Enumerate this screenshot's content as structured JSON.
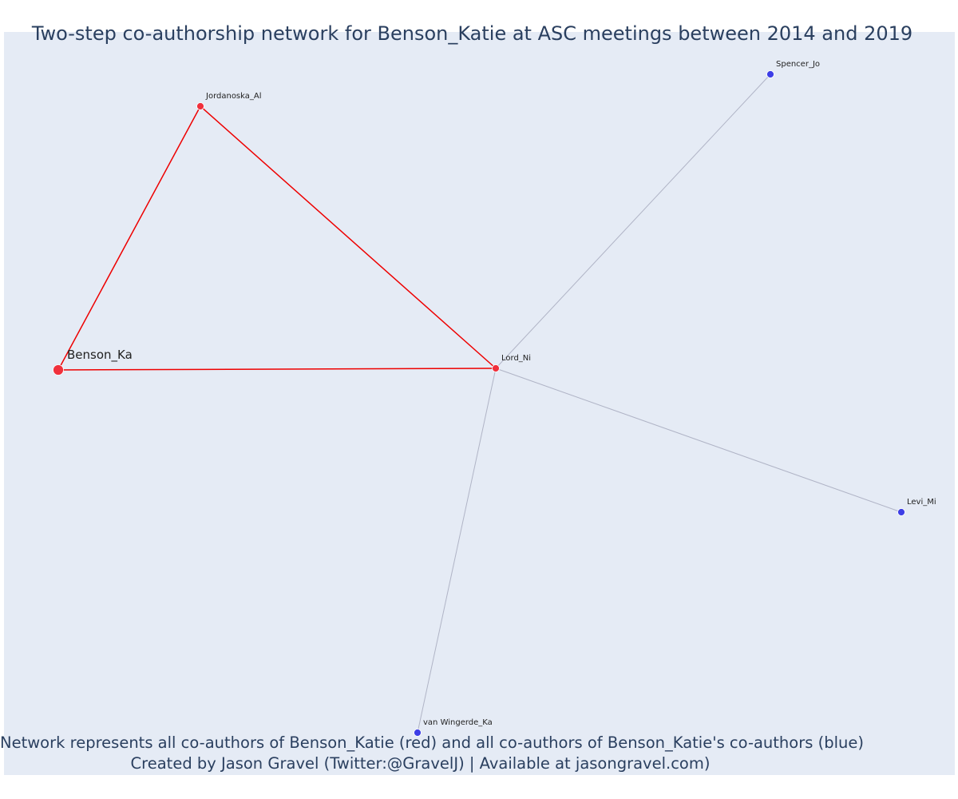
{
  "title": "Two-step co-authorship network for Benson_Katie at ASC meetings between 2014 and 2019",
  "caption": {
    "line1": "Network represents all co-authors of Benson_Katie (red) and all co-authors of Benson_Katie's co-authors (blue)",
    "line2": "Created by Jason Gravel (Twitter:@GravelJ) | Available at jasongravel.com)"
  },
  "colors": {
    "background": "#e5ebf5",
    "first_degree": "#f0303c",
    "second_degree": "#3d3ee6",
    "first_degree_edge": "#ee0000",
    "second_degree_edge": "#b0b4c6",
    "text": "#2a3f5f"
  },
  "nodes": [
    {
      "id": "Benson_Ka",
      "label": "Benson_Ka",
      "group": "focal"
    },
    {
      "id": "Jordanoska_Al",
      "label": "Jordanoska_Al",
      "group": "coauthor"
    },
    {
      "id": "Lord_Ni",
      "label": "Lord_Ni",
      "group": "coauthor"
    },
    {
      "id": "Spencer_Jo",
      "label": "Spencer_Jo",
      "group": "second"
    },
    {
      "id": "Levi_Mi",
      "label": "Levi_Mi",
      "group": "second"
    },
    {
      "id": "van Wingerde_Ka",
      "label": "van Wingerde_Ka",
      "group": "second"
    }
  ],
  "edges": [
    {
      "source": "Benson_Ka",
      "target": "Jordanoska_Al",
      "type": "first"
    },
    {
      "source": "Benson_Ka",
      "target": "Lord_Ni",
      "type": "first"
    },
    {
      "source": "Jordanoska_Al",
      "target": "Lord_Ni",
      "type": "first"
    },
    {
      "source": "Lord_Ni",
      "target": "Spencer_Jo",
      "type": "second"
    },
    {
      "source": "Lord_Ni",
      "target": "Levi_Mi",
      "type": "second"
    },
    {
      "source": "Lord_Ni",
      "target": "van Wingerde_Ka",
      "type": "second"
    }
  ]
}
